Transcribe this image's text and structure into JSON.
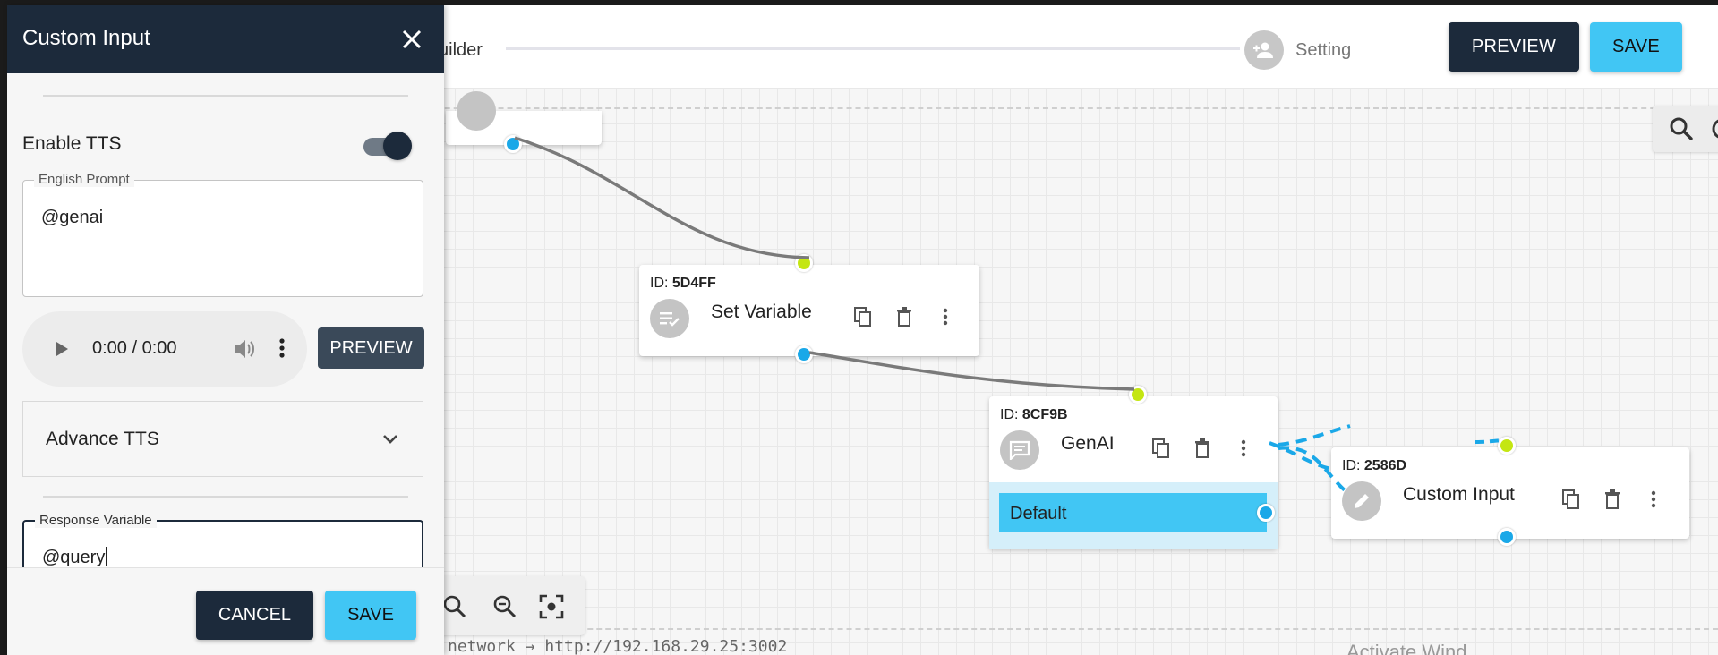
{
  "colors": {
    "navy": "#1c2a3b",
    "accent_cyan": "#41c6f4",
    "port_in": "#c4e612",
    "port_out": "#1aa8e8",
    "edge": "#777777",
    "edge_dashed": "#1aa8e8"
  },
  "header": {
    "steps": [
      {
        "label": "uilder",
        "icon": "builder-step-icon"
      },
      {
        "label": "Setting",
        "icon": "add-user-icon"
      }
    ],
    "preview_label": "PREVIEW",
    "save_label": "SAVE"
  },
  "canvas": {
    "nodes": {
      "set_variable": {
        "id_prefix": "ID:",
        "id": "5D4FF",
        "title": "Set Variable",
        "icon": "set-variable-icon"
      },
      "genai": {
        "id_prefix": "ID:",
        "id": "8CF9B",
        "title": "GenAI",
        "icon": "chat-icon",
        "route_label": "Default"
      },
      "custom_input": {
        "id_prefix": "ID:",
        "id": "2586D",
        "title": "Custom Input",
        "icon": "pencil-icon"
      }
    },
    "node_actions": [
      "copy-icon",
      "delete-icon",
      "more-vert-icon"
    ],
    "zoom_controls": [
      "zoom-in-icon",
      "zoom-out-icon",
      "fit-screen-icon"
    ],
    "status_text": "network → http://192.168.29.25:3002",
    "watermark_text": "Activate Wind"
  },
  "panel": {
    "title": "Custom Input",
    "enable_tts_label": "Enable TTS",
    "enable_tts_on": true,
    "english_prompt_label": "English Prompt",
    "english_prompt_value": "@genai",
    "audio_time": "0:00 / 0:00",
    "preview_label": "PREVIEW",
    "advance_tts_label": "Advance TTS",
    "response_variable_label": "Response Variable",
    "response_variable_value": "@query",
    "cancel_label": "CANCEL",
    "save_label": "SAVE"
  }
}
